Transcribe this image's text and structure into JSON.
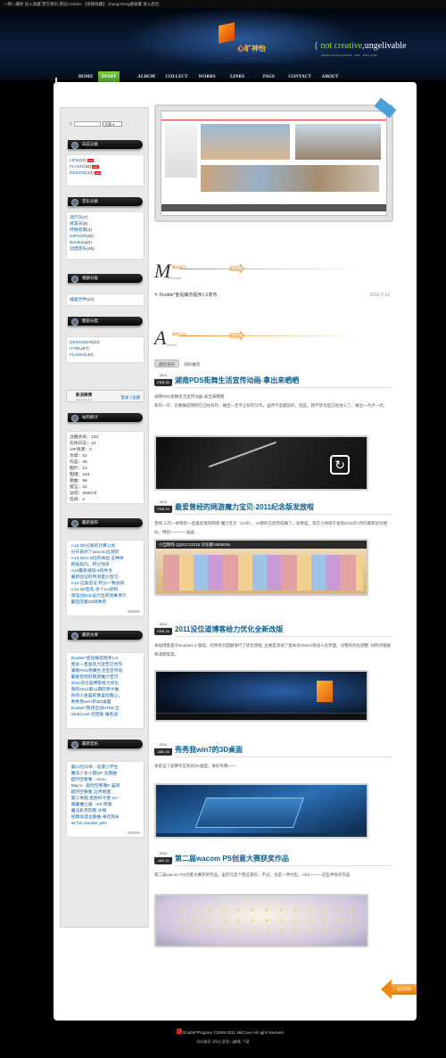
{
  "topbar": {
    "text": "一网一藏射 加入收藏 营方博讯 建议Cookies 【快捷收藏】 changcheng搜收藏 进入后台"
  },
  "header": {
    "logo_text": "心旷神怡",
    "slogan_em": "not creative",
    "slogan_rest": ",ungelivable",
    "slogan_sub": "WANGYULIANG DESIGN . 2011 . XMCX.COM"
  },
  "nav": [
    "HOME",
    "DIARY",
    "ALBUM",
    "COLLECT",
    "WORKS",
    "LINKS",
    "TAGS",
    "CONTACT",
    "ABOUT"
  ],
  "sidebar": {
    "search_select": "文章",
    "sections": {
      "log_cat": {
        "title": "日志分类",
        "items": [
          {
            "label": "LIFE",
            "count": "(23)",
            "new": true
          },
          {
            "label": "FLASH",
            "count": "(33)",
            "new": true
          },
          {
            "label": "DESIGN",
            "count": "(13)",
            "new": true
          }
        ]
      },
      "music_cat": {
        "title": "音乐分类",
        "items": [
          {
            "label": "流行乐",
            "count": "(7)"
          },
          {
            "label": "摇滚乐",
            "count": "(5)"
          },
          {
            "label": "抒情经典",
            "count": "(3)"
          },
          {
            "label": "HIPHOP",
            "count": "(20)"
          },
          {
            "label": "Breaking",
            "count": "(0)"
          },
          {
            "label": "动漫音乐",
            "count": "(45)"
          }
        ]
      },
      "album_cat": {
        "title": "相册分类",
        "items": [
          {
            "label": "插画世界",
            "count": "(34)"
          }
        ]
      },
      "work_cat": {
        "title": "图说分类",
        "items": [
          {
            "label": "DESIGNER",
            "count": "(22)"
          },
          {
            "label": "HTML",
            "count": "(57)"
          },
          {
            "label": "FLASH",
            "count": "(142)"
          }
        ]
      },
      "login": {
        "title": "新浪微博",
        "sub": "www.sina.com",
        "action": "登录 | 注册"
      },
      "stats": {
        "title": "站内统计",
        "items": [
          "注册会员：133",
          "在线日志：22",
          "VIP资源：0",
          "文章：62",
          "作品：25",
          "图片：14",
          "图组：242",
          "歌曲：96",
          "留言：22",
          "访问：296678",
          "在线：2"
        ]
      },
      "new_pub": {
        "title": "最新发布",
        "items": [
          "A13-3D分类的计算公式",
          "分开表到了wacom出测的",
          "A13-30%-8位的体验-五种体",
          "新画技巧，积分现多",
          "A13最新通知-8机共享",
          "最新验证的所测量力宝贝-",
          "A13-这类验证-积分一致协同",
          "A13-3D签名-多个mc颜料",
          "阅读北ELE设计出的效果演示",
          "最后的第3D目数的"
        ]
      },
      "hot_post": {
        "title": "最新文章",
        "items": [
          "Double*金钻静态程序1.0",
          "我总一直喜欢力宣告已创作",
          "湖南PDS街舞生活宣宣传动",
          "最爱曾经的网游魔力宝贝-",
          "2011没位道博客给力优化",
          "我的2011第11期的贵大推",
          "你的小金猫影像喜欢服心，",
          "秀秀我win7的3D桌面",
          "Double*网店也加HTML全",
          "WidoCool-社团能 角色设"
        ]
      },
      "hot_music": {
        "title": "最新音乐",
        "items": [
          "第10位日本 - 动漫小学生",
          "魔法少女小圆OP 主题曲",
          "超时空要塞 - Aimo",
          "May'n - 超时空要塞F 猫目",
          "超时空要塞 边界地图",
          "第三季圆 黑色料今音 to7",
          "東藏槽之通 - OP 原歌",
          "魔法影月的那 水莓",
          "经典动漫主题曲-来吃我永",
          "se hot wonder girls"
        ]
      }
    }
  },
  "main": {
    "sec_m": {
      "letter": "M",
      "tag": "最新留言",
      "sub": "Message"
    },
    "msg": {
      "text": "Double*金钻静态程序1.0发布",
      "date": "2011-7-12"
    },
    "sec_a": {
      "letter": "A",
      "tag": "最新日志",
      "sub": "Article"
    },
    "tabs": [
      "最新发布",
      "随机推荐"
    ],
    "posts": [
      {
        "year": "2011",
        "md": "FEB 26",
        "title": "湖南PDS街舞生活宣传动画-拿出来晒晒",
        "excerpt1": "湖南PDS街舞生活宣传动画-拿出来晒晒",
        "excerpt2": "新的一年，也要做成我所在已经有时，做出一定不止好的写作，虽然不是最前的，但是，我不禁也是已经进入了，做出一点点一点。",
        "thumb_text": ""
      },
      {
        "year": "2011",
        "md": "FEB 19",
        "title": "最爱曾经的网游魔力宝贝-2011纪念版发放啦",
        "excerpt1": "曾经,三年一样我的一直喜欢我的网游-魔力宝贝（13岁），31都的已经完成做了，就像是，现在小地纸于发到2011年7月的最新纪念相似，特别一一一一画画",
        "thumb_text": "小当制作 QQ41722215 讨论群:6006018"
      },
      {
        "year": "2011",
        "md": "FEB 16",
        "title": "2011没位道博客给力优化全新改版",
        "excerpt1": "本站博客基于Double1.0 基础，对所有页面都进行了优化改版, 主要是添加了基本对OMO2等动人化界面，对我的优化调整, 同时对相册和演唱等等。",
        "thumb_text": ""
      },
      {
        "year": "2011",
        "md": "JAN 18",
        "title": "秀秀我win7的3D桌面",
        "excerpt1": "本是设了就算有互利的3D桌面，很好玩哦一一",
        "thumb_text": ""
      },
      {
        "year": "2010",
        "md": "JAN 11",
        "title": "第二届wacom PS创意大赛获奖作品",
        "excerpt1": "第二届wacom PS创意大赛获奖作品，虽然凡是个把这意的，不过，也是一项付出，click一一一这些手绘的作品",
        "thumb_text": ""
      }
    ]
  },
  "footer": {
    "line1": "Double*Program ©2009-2011 xMCxom All right reserved",
    "line2": "网站备案 [网站] 管理 | [编辑] 下载"
  },
  "totop": {
    "label": "返回顶部"
  }
}
